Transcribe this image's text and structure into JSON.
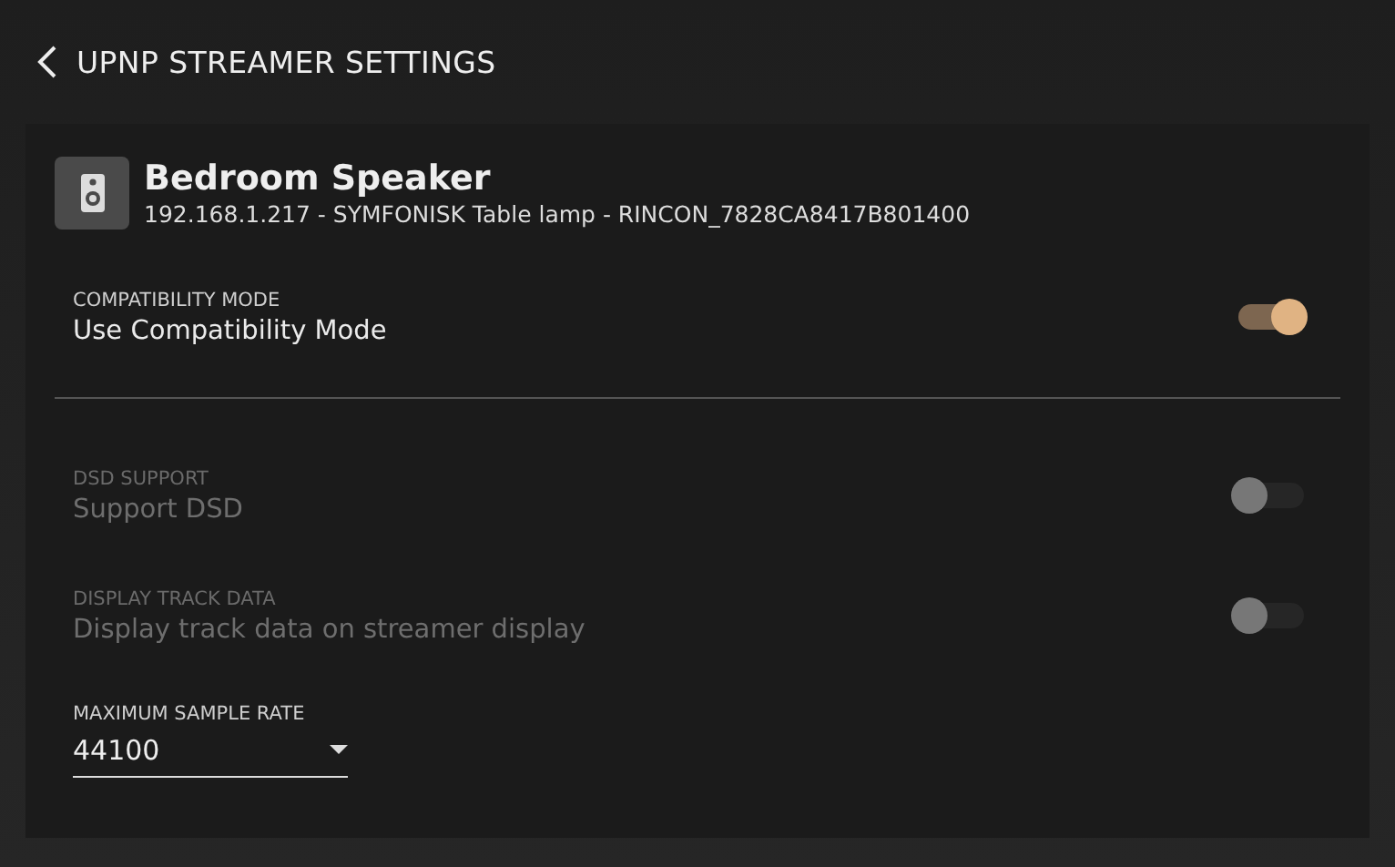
{
  "header": {
    "title": "UPNP STREAMER SETTINGS"
  },
  "device": {
    "name": "Bedroom Speaker",
    "details": "192.168.1.217 - SYMFONISK Table lamp - RINCON_7828CA8417B801400"
  },
  "settings": [
    {
      "kind": "toggle",
      "label": "COMPATIBILITY MODE",
      "text": "Use Compatibility Mode",
      "on": true,
      "disabled": false,
      "divider_after": true
    },
    {
      "kind": "toggle",
      "label": "DSD SUPPORT",
      "text": "Support DSD",
      "on": false,
      "disabled": true,
      "divider_after": false
    },
    {
      "kind": "toggle",
      "label": "DISPLAY TRACK DATA",
      "text": "Display track data on streamer display",
      "on": false,
      "disabled": true,
      "divider_after": false
    },
    {
      "kind": "select",
      "label": "MAXIMUM SAMPLE RATE",
      "value": "44100",
      "disabled": false,
      "divider_after": false
    }
  ]
}
